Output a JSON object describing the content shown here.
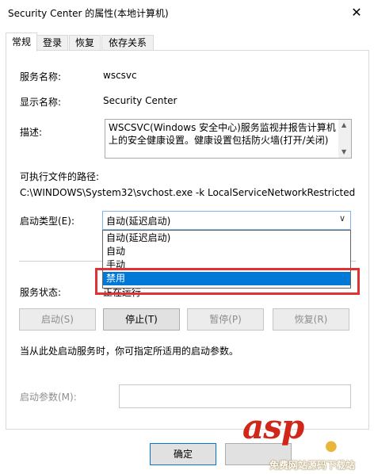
{
  "window": {
    "title": "Security Center 的属性(本地计算机)",
    "close_glyph": "✕"
  },
  "tabs": [
    {
      "label": "常规",
      "active": true
    },
    {
      "label": "登录",
      "active": false
    },
    {
      "label": "恢复",
      "active": false
    },
    {
      "label": "依存关系",
      "active": false
    }
  ],
  "general": {
    "service_name_label": "服务名称:",
    "service_name": "wscsvc",
    "display_name_label": "显示名称:",
    "display_name": "Security Center",
    "description_label": "描述:",
    "description": "WSCSVC(Windows 安全中心)服务监视并报告计算机上的安全健康设置。健康设置包括防火墙(打开/关闭)",
    "exe_path_label": "可执行文件的路径:",
    "exe_path": "C:\\WINDOWS\\System32\\svchost.exe -k LocalServiceNetworkRestricted",
    "startup_type_label": "启动类型(E):",
    "startup_type_value": "自动(延迟启动)",
    "startup_options": [
      "自动(延迟启动)",
      "自动",
      "手动",
      "禁用"
    ],
    "startup_selected_index": 3,
    "status_label": "服务状态:",
    "status_value": "正在运行",
    "buttons": {
      "start": "启动(S)",
      "stop": "停止(T)",
      "pause": "暂停(P)",
      "resume": "恢复(R)"
    },
    "hint": "当从此处启动服务时，你可指定所适用的启动参数。",
    "start_params_label": "启动参数(M):",
    "start_params_value": ""
  },
  "footer": {
    "ok": "确定",
    "cancel": ""
  },
  "watermark": {
    "main": "asp",
    "dot": "●",
    "sub": "免费网站源码下载站"
  },
  "colors": {
    "selection": "#0078d7",
    "highlight_box": "#e03232",
    "watermark": "#d0271a"
  }
}
